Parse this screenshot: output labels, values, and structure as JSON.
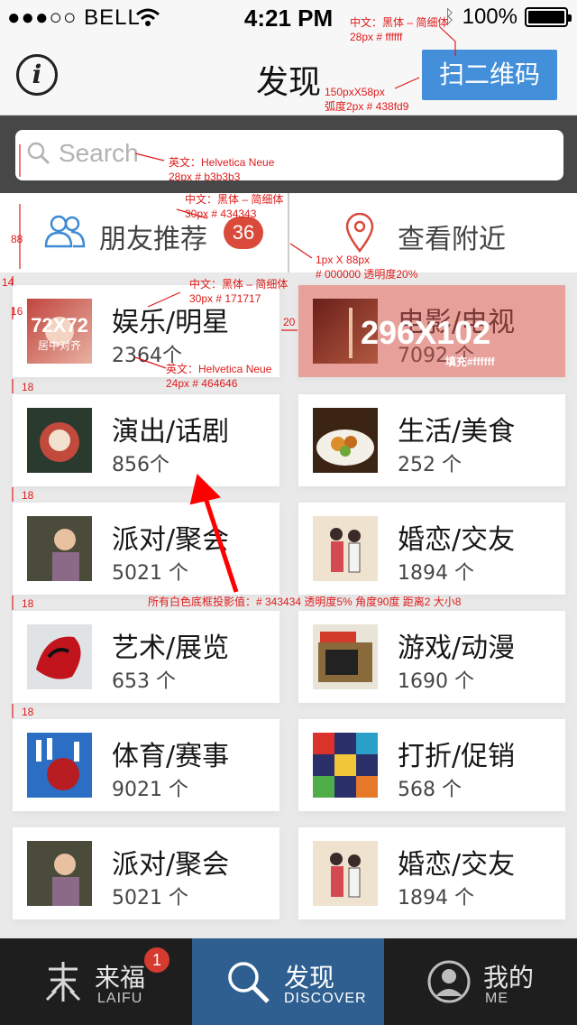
{
  "status_bar": {
    "carrier": "●●●○○ BELL",
    "time": "4:21 PM",
    "battery": "100%"
  },
  "nav": {
    "title": "发现",
    "qr_button": "扫二维码"
  },
  "search": {
    "placeholder": "Search"
  },
  "segment": {
    "friends_label": "朋友推荐",
    "friends_badge": "36",
    "nearby_label": "查看附近"
  },
  "categories": [
    {
      "title": "娱乐/明星",
      "count": "2364个"
    },
    {
      "title": "电影/电视",
      "count": "7092 个"
    },
    {
      "title": "演出/话剧",
      "count": "856个"
    },
    {
      "title": "生活/美食",
      "count": "252 个"
    },
    {
      "title": "派对/聚会",
      "count": "5021 个"
    },
    {
      "title": "婚恋/交友",
      "count": "1894 个"
    },
    {
      "title": "艺术/展览",
      "count": "653 个"
    },
    {
      "title": "游戏/动漫",
      "count": "1690 个"
    },
    {
      "title": "体育/赛事",
      "count": "9021 个"
    },
    {
      "title": "打折/促销",
      "count": "568 个"
    },
    {
      "title": "派对/聚会",
      "count": "5021 个"
    },
    {
      "title": "婚恋/交友",
      "count": "1894 个"
    }
  ],
  "tabbar": {
    "tab1": {
      "label": "来福",
      "sub": "LAIFU",
      "badge": "1"
    },
    "tab2": {
      "label": "发现",
      "sub": "DISCOVER"
    },
    "tab3": {
      "label": "我的",
      "sub": "ME"
    }
  },
  "annotations": {
    "qr_font": "中文：黑体 – 简细体",
    "qr_size": "28px    # ffffff",
    "qr_dims": "150pxX58px",
    "qr_radius": "弧度2px  # 438fd9",
    "search_font": "英文：Helvetica Neue",
    "search_size": "28px    # b3b3b3",
    "seg_font": "中文：黑体 – 简细体",
    "seg_size": "30px    # 434343",
    "divider_dims": "1px X 88px",
    "divider_color": "# 000000  透明度20%",
    "title_font": "中文：黑体 – 简细体",
    "title_size": "30px    # 171717",
    "count_font": "英文：Helvetica Neue",
    "count_size": "24px    # 464646",
    "thumb_dims": "72X72",
    "thumb_align": "居中对齐",
    "card_dims": "296X102",
    "card_fill": "填充#ffffff",
    "shadow_note": "所有白色底框投影值：# 343434    透明度5%    角度90度    距离2   大小8",
    "m88": "88",
    "m14": "14",
    "m16": "16",
    "m20": "20",
    "m18a": "18",
    "m18b": "18",
    "m18c": "18",
    "m18d": "18"
  },
  "colors": {
    "accent": "#438fd9",
    "badge": "#d94a3a",
    "tab_active": "#2f5f91"
  }
}
